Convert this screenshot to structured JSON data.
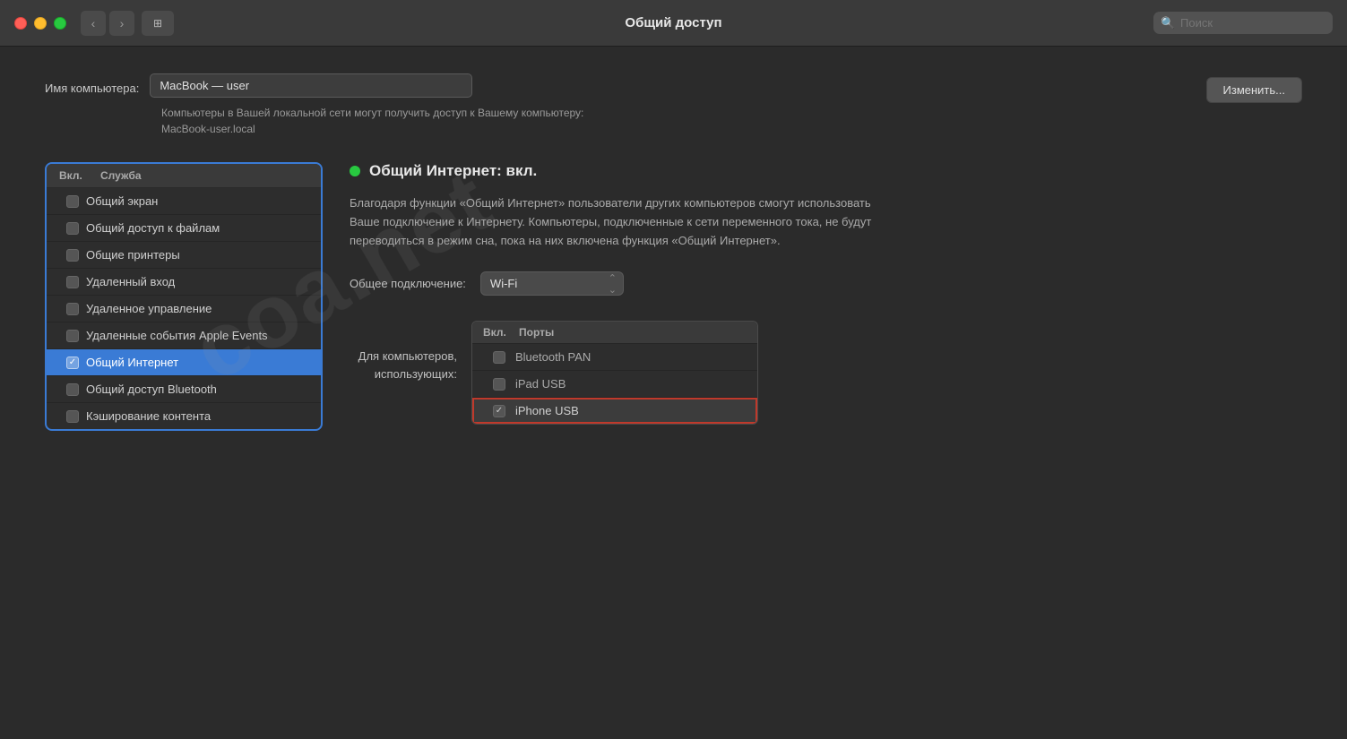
{
  "titlebar": {
    "title": "Общий доступ",
    "search_placeholder": "Поиск"
  },
  "computer_name": {
    "label": "Имя компьютера:",
    "value": "MacBook — user",
    "sublabel": "Компьютеры в Вашей локальной сети могут получить доступ к Вашему компьютеру: MacBook-user.local",
    "change_button": "Изменить..."
  },
  "services": {
    "col_enabled": "Вкл.",
    "col_service": "Служба",
    "items": [
      {
        "id": "screen",
        "label": "Общий экран",
        "checked": false,
        "selected": false
      },
      {
        "id": "files",
        "label": "Общий доступ к файлам",
        "checked": false,
        "selected": false
      },
      {
        "id": "printers",
        "label": "Общие принтеры",
        "checked": false,
        "selected": false
      },
      {
        "id": "remote-login",
        "label": "Удаленный вход",
        "checked": false,
        "selected": false
      },
      {
        "id": "remote-mgmt",
        "label": "Удаленное управление",
        "checked": false,
        "selected": false
      },
      {
        "id": "apple-events",
        "label": "Удаленные события Apple Events",
        "checked": false,
        "selected": false
      },
      {
        "id": "internet",
        "label": "Общий Интернет",
        "checked": true,
        "selected": true
      },
      {
        "id": "bluetooth",
        "label": "Общий доступ Bluetooth",
        "checked": false,
        "selected": false
      },
      {
        "id": "cache",
        "label": "Кэширование контента",
        "checked": false,
        "selected": false
      }
    ]
  },
  "right_panel": {
    "status_title": "Общий Интернет: вкл.",
    "description": "Благодаря функции «Общий Интернет» пользователи других компьютеров смогут использовать Ваше подключение к Интернету. Компьютеры, подключенные к сети переменного тока, не будут переводиться в режим сна, пока на них включена функция «Общий Интернет».",
    "connection_label": "Общее подключение:",
    "connection_value": "Wi-Fi",
    "for_computers_label": "Для компьютеров,\nиспользующих:",
    "ports": {
      "col_enabled": "Вкл.",
      "col_ports": "Порты",
      "items": [
        {
          "id": "bluetooth-pan",
          "label": "Bluetooth PAN",
          "checked": false,
          "highlighted": false
        },
        {
          "id": "ipad-usb",
          "label": "iPad USB",
          "checked": false,
          "highlighted": false
        },
        {
          "id": "iphone-usb",
          "label": "iPhone USB",
          "checked": true,
          "highlighted": true
        }
      ]
    }
  },
  "watermark": "coa.net"
}
